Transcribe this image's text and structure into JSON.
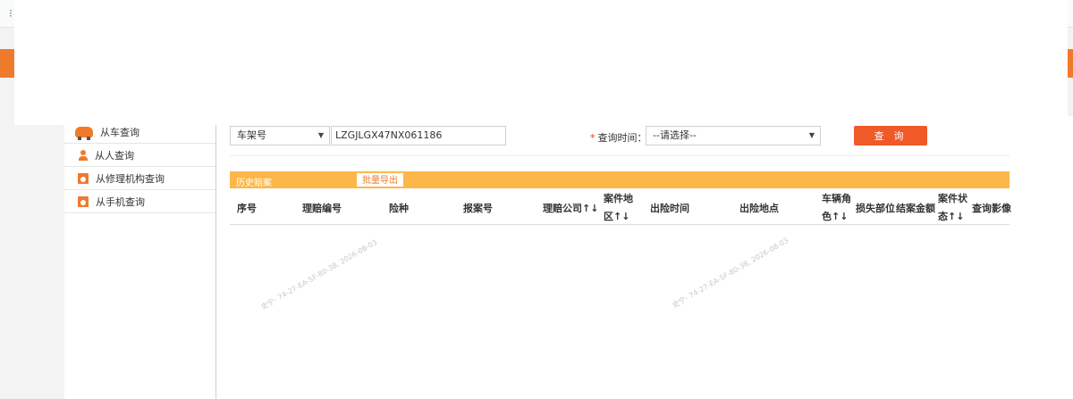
{
  "sidebar": {
    "items": [
      {
        "label": "从车查询",
        "icon": "car-icon"
      },
      {
        "label": "从人查询",
        "icon": "person-icon"
      },
      {
        "label": "从修理机构查询",
        "icon": "repair-shop-icon"
      },
      {
        "label": "从手机查询",
        "icon": "phone-query-icon"
      }
    ]
  },
  "search": {
    "field_type": "车架号",
    "vin_value": "LZGJLGX47NX061186",
    "time_label": "查询时间：",
    "required_mark": "*",
    "time_select": "--请选择--",
    "query_button": "查 询"
  },
  "history": {
    "title": "历史赔案",
    "export_button": "批量导出"
  },
  "table": {
    "headers": {
      "seq": "序号",
      "claim_no": "理赔编号",
      "insurance_type": "险种",
      "report_no": "报案号",
      "claim_company": "理赔公司↑↓",
      "case_region": "案件地区↑↓",
      "accident_time": "出险时间",
      "accident_place": "出险地点",
      "vehicle_role": "车辆角色↑↓",
      "damage_part": "损失部位",
      "settle_amount": "结案金额",
      "case_status": "案件状态↑↓",
      "query_image": "查询影像"
    }
  },
  "watermark": "史宁- 74-27-EA-5F-80-38, 2026-08-03",
  "colors": {
    "accent": "#f07a2c",
    "query_button": "#f05a28",
    "history_bar": "#fbb74a",
    "required": "#e23b1c"
  }
}
